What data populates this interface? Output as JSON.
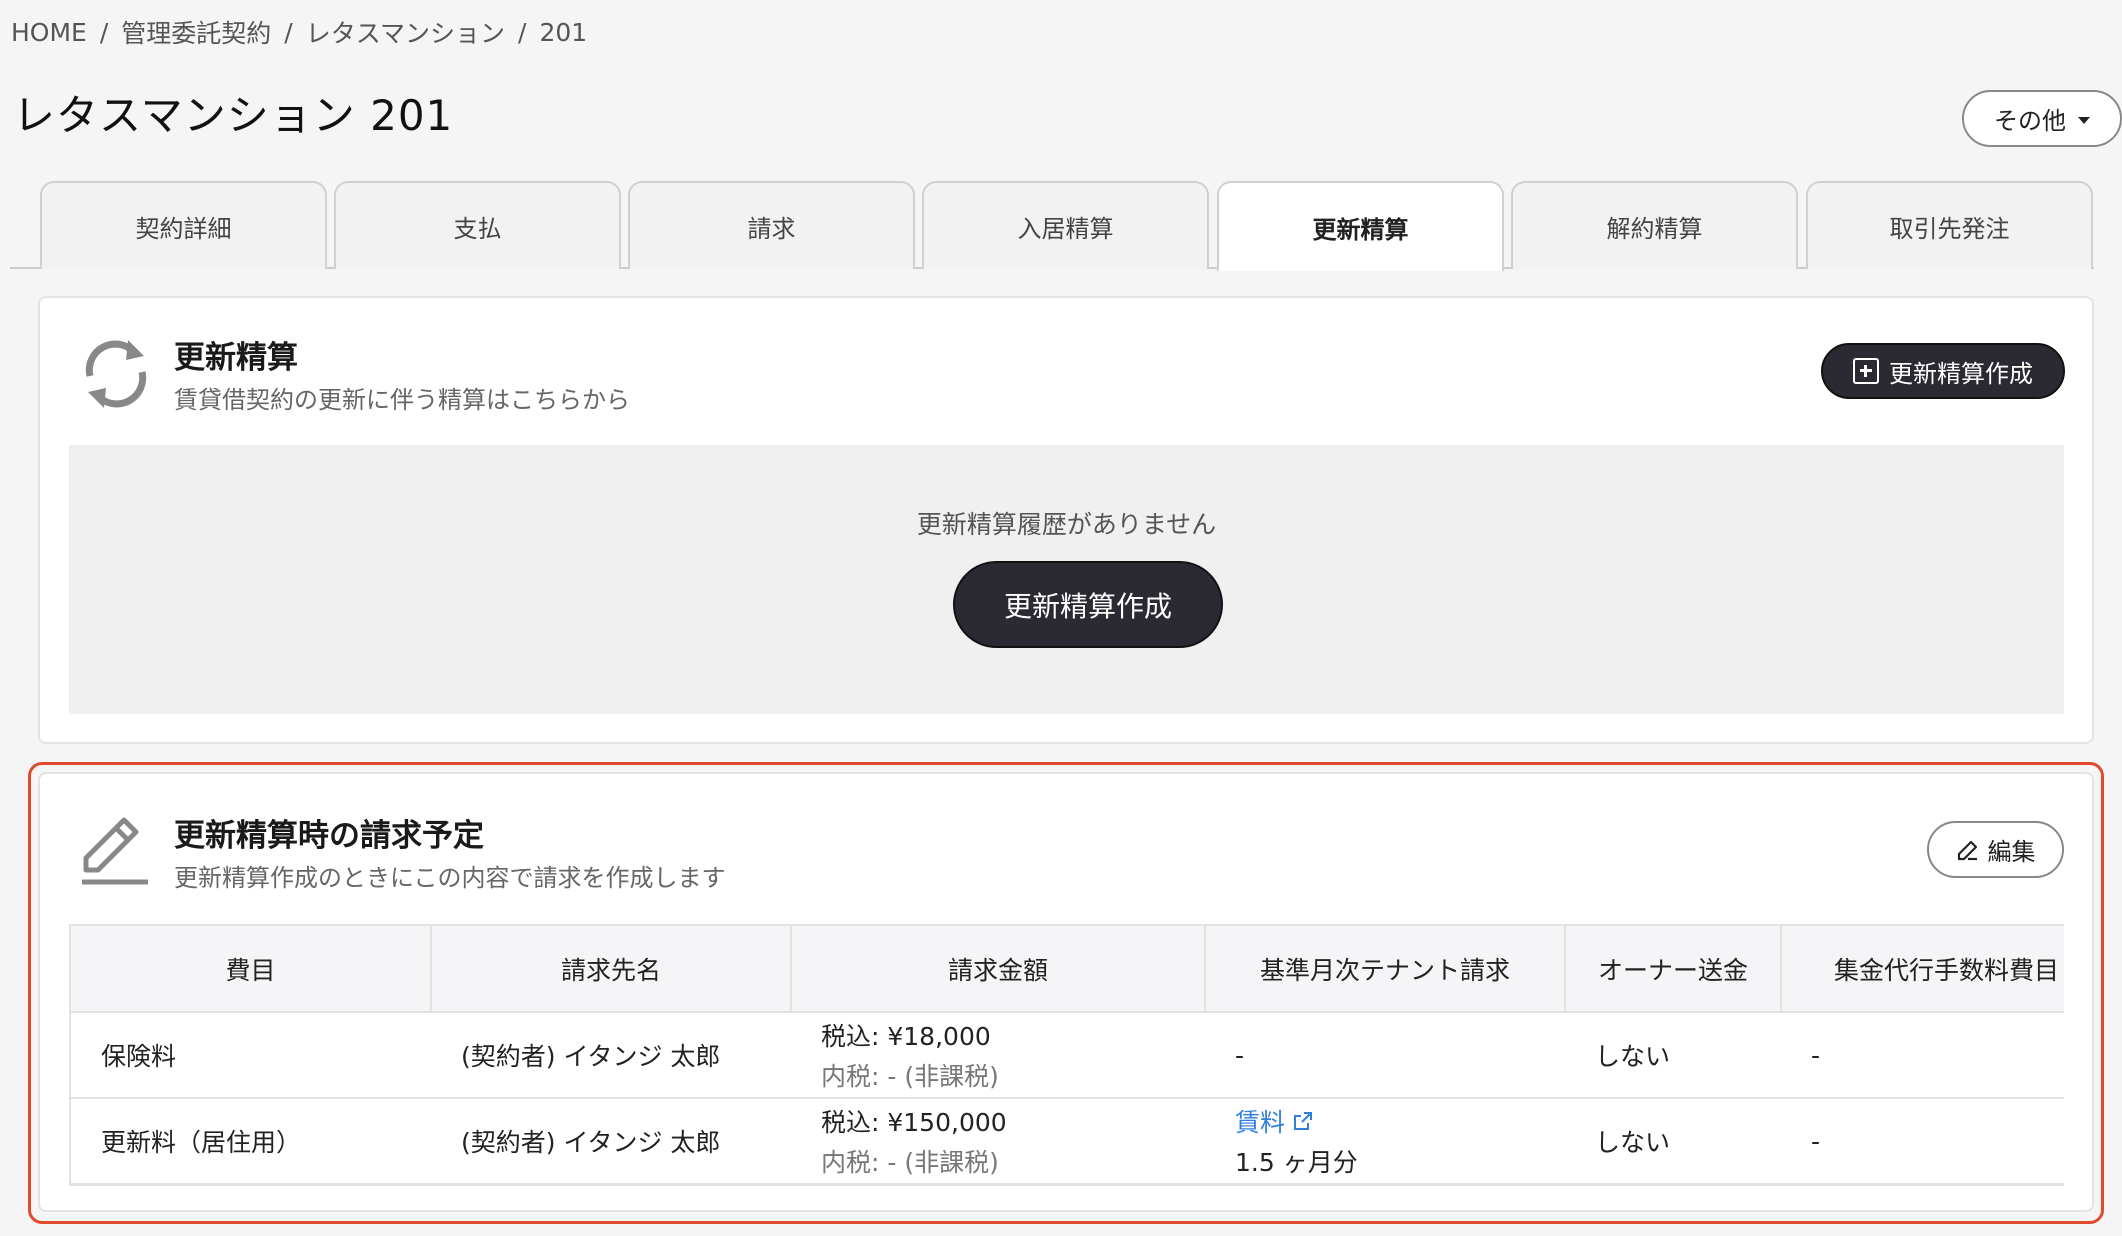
{
  "breadcrumb": {
    "items": [
      "HOME",
      "管理委託契約",
      "レタスマンション",
      "201"
    ],
    "separator": "/"
  },
  "page_title": "レタスマンション 201",
  "other_button": "その他",
  "tabs": [
    {
      "label": "契約詳細",
      "active": false
    },
    {
      "label": "支払",
      "active": false
    },
    {
      "label": "請求",
      "active": false
    },
    {
      "label": "入居精算",
      "active": false
    },
    {
      "label": "更新精算",
      "active": true
    },
    {
      "label": "解約精算",
      "active": false
    },
    {
      "label": "取引先発注",
      "active": false
    }
  ],
  "renewal_section": {
    "title": "更新精算",
    "subtitle": "賃貸借契約の更新に伴う精算はこちらから",
    "create_button": "更新精算作成",
    "empty_text": "更新精算履歴がありません",
    "empty_create_button": "更新精算作成"
  },
  "billing_section": {
    "title": "更新精算時の請求予定",
    "subtitle": "更新精算作成のときにこの内容で請求を作成します",
    "edit_button": "編集",
    "columns": [
      "費目",
      "請求先名",
      "請求金額",
      "基準月次テナント請求",
      "オーナー送金",
      "集金代行手数料費目"
    ],
    "rows": [
      {
        "item": "保険料",
        "payer": "(契約者) イタンジ 太郎",
        "amount": "税込: ¥18,000",
        "tax": "内税: - (非課税)",
        "base_monthly": "-",
        "base_monthly_sub": "",
        "owner_remit": "しない",
        "fee_item": "-"
      },
      {
        "item": "更新料（居住用）",
        "payer": "(契約者) イタンジ 太郎",
        "amount": "税込: ¥150,000",
        "tax": "内税: - (非課税)",
        "base_monthly": "賃料",
        "base_monthly_sub": "1.5 ヶ月分",
        "owner_remit": "しない",
        "fee_item": "-"
      }
    ]
  },
  "colors": {
    "highlight_frame": "#e04a2f",
    "dark_button": "#2b2a33",
    "link": "#2f7ee0"
  }
}
